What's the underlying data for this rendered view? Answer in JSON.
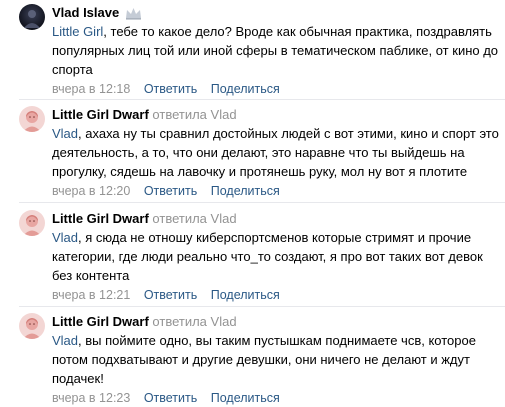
{
  "comments": [
    {
      "author": "Vlad Islave",
      "has_crown": true,
      "avatar": "dark-avatar",
      "mention": "Little Girl",
      "text": ", тебе то какое дело? Вроде как обычная практика, поздравлять популярных лиц той или иной сферы в тематическом паблике, от кино до спорта",
      "time": "вчера в 12:18",
      "reply_label": "Ответить",
      "share_label": "Поделиться"
    },
    {
      "author": "Little Girl Dwarf",
      "reply_word": "ответила",
      "reply_to": "Vlad",
      "avatar": "girl-avatar",
      "mention": "Vlad",
      "text": ", ахаха ну ты сравнил достойных людей с вот этими, кино и спорт это деятельность, а то, что они делают, это наравне что ты выйдешь на прогулку, сядешь на лавочку и протянешь руку, мол ну вот я плотите",
      "time": "вчера в 12:20",
      "reply_label": "Ответить",
      "share_label": "Поделиться"
    },
    {
      "author": "Little Girl Dwarf",
      "reply_word": "ответила",
      "reply_to": "Vlad",
      "avatar": "girl-avatar",
      "mention": "Vlad",
      "text": ", я сюда не отношу киберспортсменов которые стримят и прочие категории, где люди реально что_то создают, я про вот таких вот девок без контента",
      "time": "вчера в 12:21",
      "reply_label": "Ответить",
      "share_label": "Поделиться"
    },
    {
      "author": "Little Girl Dwarf",
      "reply_word": "ответила",
      "reply_to": "Vlad",
      "avatar": "girl-avatar",
      "mention": "Vlad",
      "text": ", вы поймите одно, вы таким пустышкам поднимаете чсв, которое потом подхватывают и другие девушки, они ничего не делают и ждут подачек!",
      "time": "вчера в 12:23",
      "reply_label": "Ответить",
      "share_label": "Поделиться"
    }
  ],
  "colors": {
    "link": "#2a5885",
    "muted": "#939393",
    "divider": "#e7e8ec"
  }
}
